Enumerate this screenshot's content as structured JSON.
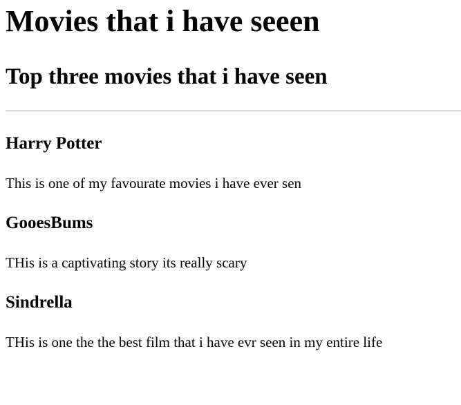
{
  "page": {
    "heading": "Movies that i have seeen",
    "subheading": "Top three movies that i have seen"
  },
  "movies": [
    {
      "title": "Harry Potter",
      "description": "This is one of my favourate movies i have ever sen"
    },
    {
      "title": "GooesBums",
      "description": "THis is a captivating story its really scary"
    },
    {
      "title": "Sindrella",
      "description": "THis is one the the best film that i have evr seen in my entire life"
    }
  ]
}
